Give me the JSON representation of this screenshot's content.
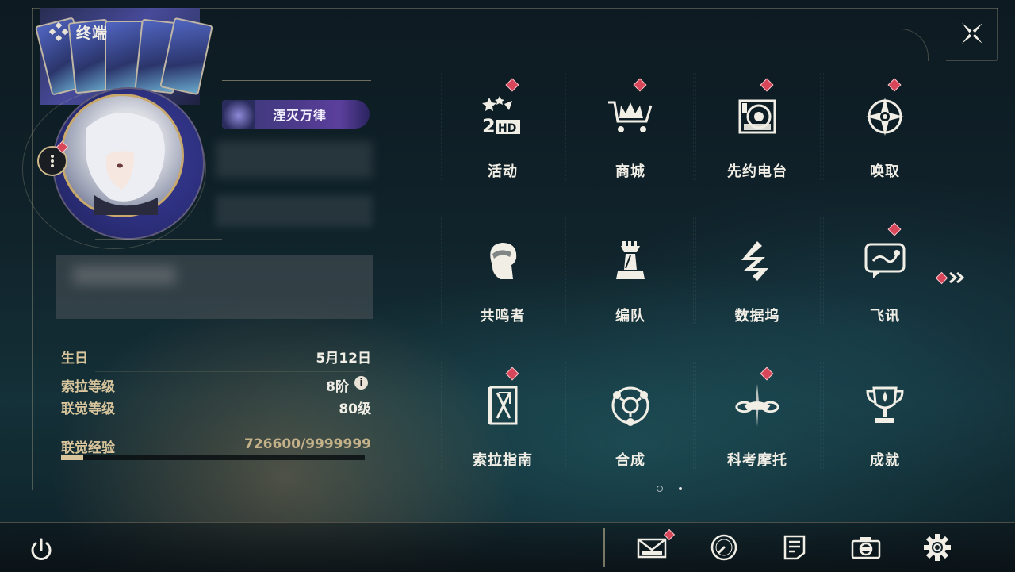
{
  "header": {
    "title": "终端"
  },
  "profile": {
    "title_badge": "湮灭万律"
  },
  "stats": {
    "birthday_label": "生日",
    "birthday_value": "5月12日",
    "sola_level_label": "索拉等级",
    "sola_level_value": "8阶",
    "union_level_label": "联觉等级",
    "union_level_value": "80级",
    "exp_label": "联觉经验",
    "exp_value": "726600/9999999",
    "exp_progress": 0.0727
  },
  "menu": {
    "items": [
      {
        "label": "活动",
        "icon": "event-2nd-anniversary-icon",
        "badge": true
      },
      {
        "label": "商城",
        "icon": "shop-cart-icon",
        "badge": true
      },
      {
        "label": "先约电台",
        "icon": "radio-icon",
        "badge": true
      },
      {
        "label": "唤取",
        "icon": "convene-star-icon",
        "badge": true
      },
      {
        "label": "共鸣者",
        "icon": "resonator-head-icon",
        "badge": false
      },
      {
        "label": "编队",
        "icon": "chess-team-icon",
        "badge": false
      },
      {
        "label": "数据坞",
        "icon": "data-bank-icon",
        "badge": false
      },
      {
        "label": "飞讯",
        "icon": "message-chat-icon",
        "badge": true
      },
      {
        "label": "索拉指南",
        "icon": "guide-book-icon",
        "badge": true
      },
      {
        "label": "合成",
        "icon": "synthesis-icon",
        "badge": false
      },
      {
        "label": "科考摩托",
        "icon": "motorbike-icon",
        "badge": true
      },
      {
        "label": "成就",
        "icon": "trophy-icon",
        "badge": false
      }
    ],
    "next_page_badge": true,
    "page_current": 1,
    "page_total": 2
  },
  "bottom_bar": {
    "icons": [
      "power-icon",
      "mail-icon",
      "clock-icon",
      "notes-icon",
      "camera-icon",
      "settings-gear-icon"
    ],
    "mail_badge": true
  },
  "colors": {
    "accent_gold": "#d8c59c",
    "badge_red": "#d8465a",
    "text_light": "#f1eee6"
  }
}
